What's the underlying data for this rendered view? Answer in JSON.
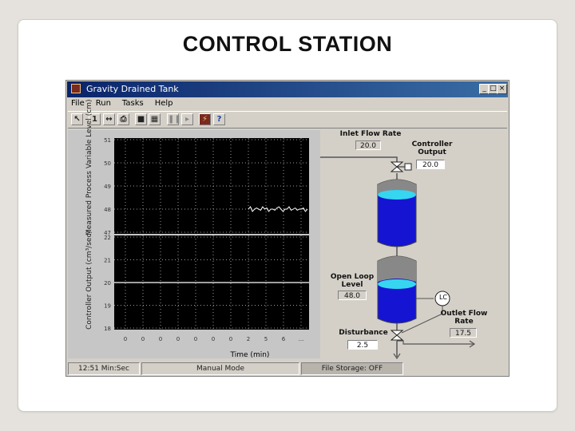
{
  "slide": {
    "title": "CONTROL STATION"
  },
  "window": {
    "title": "Gravity Drained Tank",
    "buttons": {
      "minimize": "_",
      "maximize": "□",
      "close": "×"
    }
  },
  "menu": [
    {
      "id": "file",
      "label": "File"
    },
    {
      "id": "run",
      "label": "Run"
    },
    {
      "id": "tasks",
      "label": "Tasks"
    },
    {
      "id": "help",
      "label": "Help"
    }
  ],
  "toolbar": [
    {
      "id": "select",
      "glyph": "↖"
    },
    {
      "id": "step",
      "glyph": "1"
    },
    {
      "id": "fit",
      "glyph": "↔"
    },
    {
      "id": "print",
      "glyph": "⎙"
    },
    {
      "id": "save",
      "glyph": "■"
    },
    {
      "id": "table",
      "glyph": "▦"
    },
    {
      "id": "pause",
      "glyph": "❚❚"
    },
    {
      "id": "play",
      "glyph": "▸"
    },
    {
      "id": "mode",
      "glyph": "⚡"
    },
    {
      "id": "help",
      "glyph": "?"
    }
  ],
  "plot": {
    "top": {
      "ylabel": "Measured Process Variable Level (cm)",
      "ticks": [
        "51",
        "50",
        "49",
        "48",
        "47"
      ]
    },
    "bottom": {
      "ylabel": "Controller Output (cm³/sec)",
      "ticks": [
        "22",
        "21",
        "20",
        "19",
        "18"
      ]
    },
    "xticks": [
      "0",
      "0",
      "0",
      "0",
      "0",
      "0",
      "0",
      "2",
      "5",
      "6",
      "..."
    ],
    "xlabel": "Time (min)"
  },
  "process": {
    "inlet_flow_label": "Inlet Flow Rate",
    "inlet_flow_value": "20.0",
    "controller_output_label": "Controller Output",
    "controller_output_value": "20.0",
    "open_loop_label": "Open Loop Level",
    "open_loop_value": "48.0",
    "lc_label": "LC",
    "outlet_label": "Outlet Flow Rate",
    "outlet_value": "17.5",
    "disturbance_label": "Disturbance",
    "disturbance_value": "2.5"
  },
  "status": {
    "time": "12:51 Min:Sec",
    "mode": "Manual Mode",
    "storage": "File Storage: OFF"
  },
  "chart_data": [
    {
      "type": "line",
      "ylabel": "Measured Process Variable Level (cm)",
      "ylim": [
        47,
        51
      ],
      "series": [
        {
          "values": [
            48.0,
            48.1,
            47.9,
            48.0,
            48.05,
            48.0,
            47.95,
            48.1,
            48.0,
            48.05,
            47.9,
            48.0,
            48.0,
            47.95,
            48.05,
            48.1,
            48.0,
            47.9,
            48.0,
            48.0,
            48.1,
            47.95,
            48.0,
            48.05,
            47.95,
            48.0,
            48.0,
            48.05,
            47.9,
            48.0
          ]
        }
      ]
    },
    {
      "type": "line",
      "ylabel": "Controller Output (cm³/sec)",
      "ylim": [
        18,
        22
      ],
      "series": [
        {
          "values": [
            20.0,
            20.0
          ]
        }
      ]
    }
  ]
}
